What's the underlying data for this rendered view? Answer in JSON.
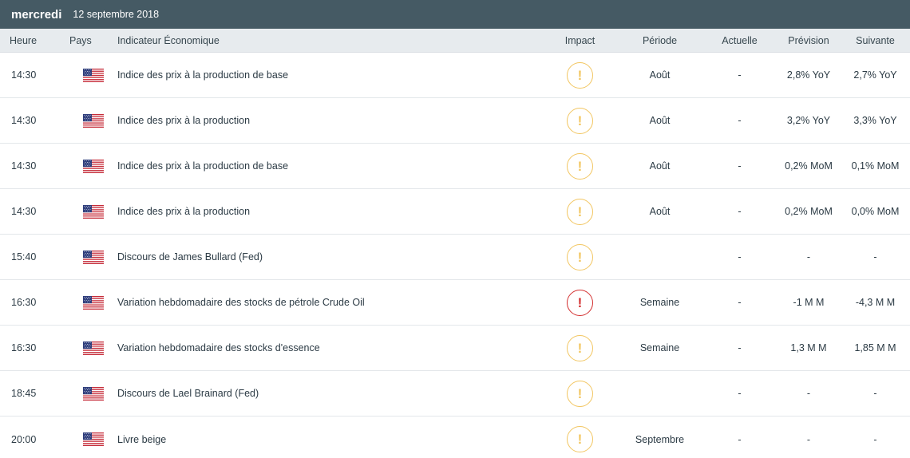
{
  "header": {
    "day": "mercredi",
    "date": "12 septembre 2018"
  },
  "columns": {
    "time": "Heure",
    "country": "Pays",
    "indicator": "Indicateur Économique",
    "impact": "Impact",
    "period": "Période",
    "actual": "Actuelle",
    "forecast": "Prévision",
    "next": "Suivante"
  },
  "colors": {
    "topbar": "#455a64",
    "impact_medium": "#f2c661",
    "impact_high": "#d32f2f"
  },
  "rows": [
    {
      "time": "14:30",
      "country": "us-flag-icon",
      "indicator": "Indice des prix à la production de base",
      "impact": "medium",
      "impact_glyph": "!",
      "period": "Août",
      "actual": "-",
      "forecast": "2,8% YoY",
      "next": "2,7% YoY"
    },
    {
      "time": "14:30",
      "country": "us-flag-icon",
      "indicator": "Indice des prix à la production",
      "impact": "medium",
      "impact_glyph": "!",
      "period": "Août",
      "actual": "-",
      "forecast": "3,2% YoY",
      "next": "3,3% YoY"
    },
    {
      "time": "14:30",
      "country": "us-flag-icon",
      "indicator": "Indice des prix à la production de base",
      "impact": "medium",
      "impact_glyph": "!",
      "period": "Août",
      "actual": "-",
      "forecast": "0,2% MoM",
      "next": "0,1% MoM"
    },
    {
      "time": "14:30",
      "country": "us-flag-icon",
      "indicator": "Indice des prix à la production",
      "impact": "medium",
      "impact_glyph": "!",
      "period": "Août",
      "actual": "-",
      "forecast": "0,2% MoM",
      "next": "0,0% MoM"
    },
    {
      "time": "15:40",
      "country": "us-flag-icon",
      "indicator": "Discours de James Bullard (Fed)",
      "impact": "medium",
      "impact_glyph": "!",
      "period": "",
      "actual": "-",
      "forecast": "-",
      "next": "-"
    },
    {
      "time": "16:30",
      "country": "us-flag-icon",
      "indicator": "Variation hebdomadaire des stocks de pétrole Crude Oil",
      "impact": "high",
      "impact_glyph": "!",
      "period": "Semaine",
      "actual": "-",
      "forecast": "-1 M M",
      "next": "-4,3 M M"
    },
    {
      "time": "16:30",
      "country": "us-flag-icon",
      "indicator": "Variation hebdomadaire des stocks d'essence",
      "impact": "medium",
      "impact_glyph": "!",
      "period": "Semaine",
      "actual": "-",
      "forecast": "1,3 M M",
      "next": "1,85 M M"
    },
    {
      "time": "18:45",
      "country": "us-flag-icon",
      "indicator": "Discours de Lael Brainard (Fed)",
      "impact": "medium",
      "impact_glyph": "!",
      "period": "",
      "actual": "-",
      "forecast": "-",
      "next": "-"
    },
    {
      "time": "20:00",
      "country": "us-flag-icon",
      "indicator": "Livre beige",
      "impact": "medium",
      "impact_glyph": "!",
      "period": "Septembre",
      "actual": "-",
      "forecast": "-",
      "next": "-"
    }
  ]
}
